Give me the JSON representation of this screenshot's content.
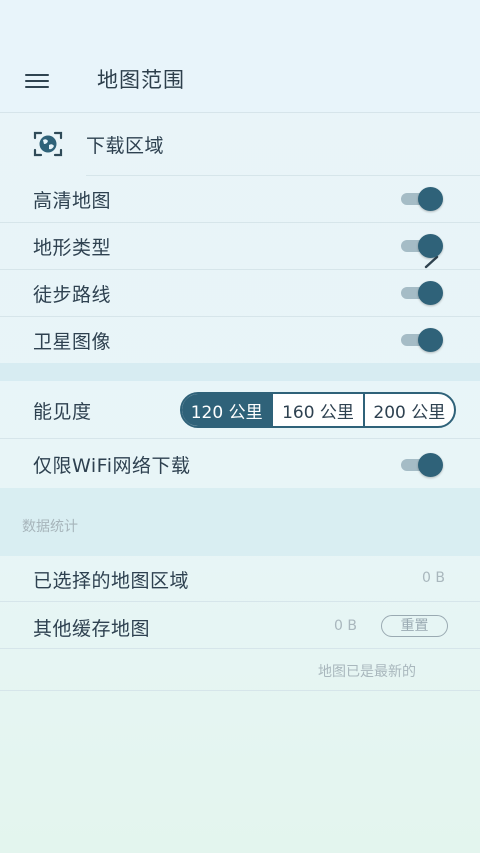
{
  "header": {
    "title": "地图范围"
  },
  "download_area": {
    "label": "下载区域"
  },
  "toggles": [
    {
      "label": "高清地图",
      "on": true
    },
    {
      "label": "地形类型",
      "on": true
    },
    {
      "label": "徒步路线",
      "on": true
    },
    {
      "label": "卫星图像",
      "on": true
    }
  ],
  "visibility": {
    "label": "能见度",
    "options": [
      "120 公里",
      "160 公里",
      "200 公里"
    ],
    "selected": "120 公里"
  },
  "wifi_only": {
    "label": "仅限WiFi网络下载",
    "on": true
  },
  "stats": {
    "title": "数据统计",
    "selected_area": {
      "label": "已选择的地图区域",
      "value": "0 B"
    },
    "other_cache": {
      "label": "其他缓存地图",
      "value": "0 B",
      "reset_label": "重置"
    },
    "status": "地图已是最新的"
  },
  "colors": {
    "accent": "#2f6279",
    "track": "#a5bcc6",
    "background": "#e9f4f9",
    "muted_text": "#a9b7bd"
  },
  "icons": {
    "menu": "hamburger-menu-icon",
    "download_area": "globe-scan-icon",
    "chevron": "chevron-right-icon"
  }
}
